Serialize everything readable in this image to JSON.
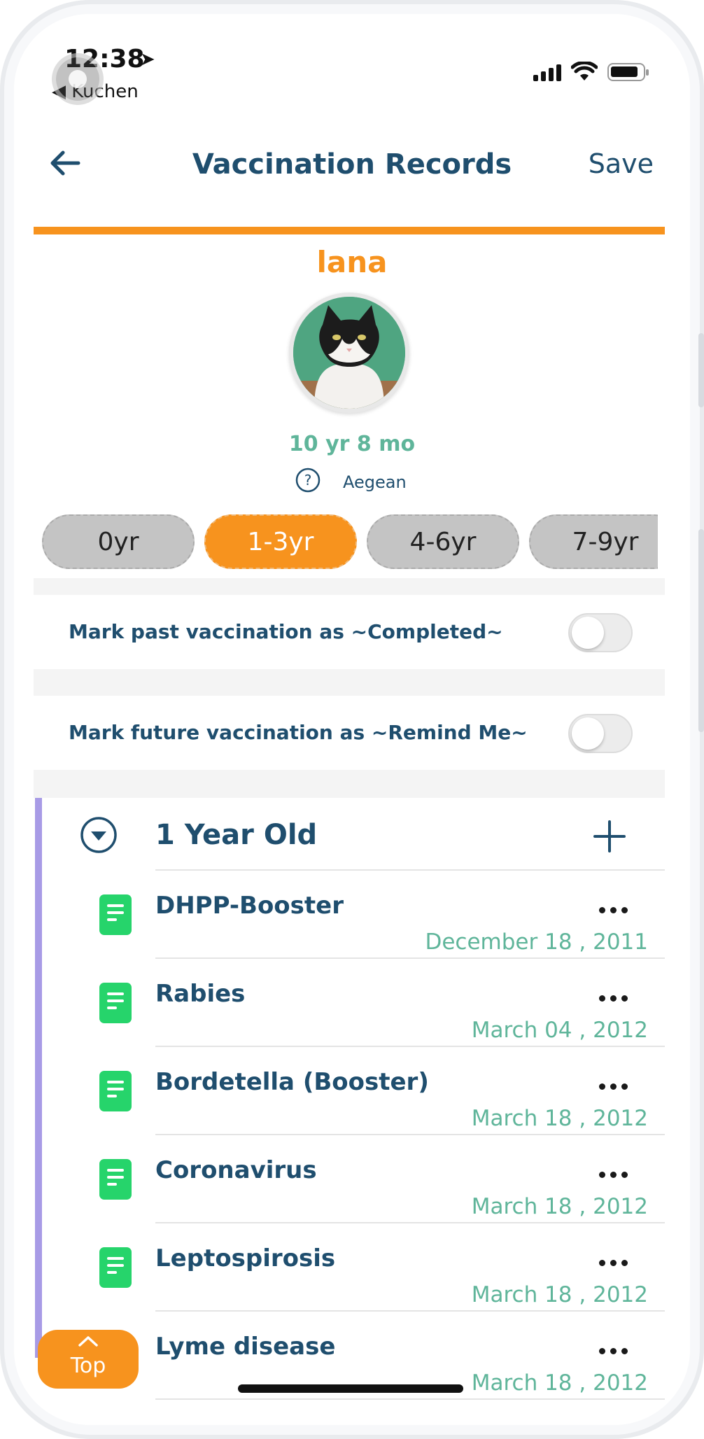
{
  "status_bar": {
    "time": "12:38",
    "back_app": "Kuchen"
  },
  "nav": {
    "title": "Vaccination Records",
    "save_label": "Save"
  },
  "pet": {
    "name": "lana",
    "age": "10 yr 8 mo",
    "breed": "Aegean"
  },
  "age_tabs": [
    {
      "label": "0yr",
      "active": false
    },
    {
      "label": "1-3yr",
      "active": true
    },
    {
      "label": "4-6yr",
      "active": false
    },
    {
      "label": "7-9yr",
      "active": false
    }
  ],
  "toggles": [
    {
      "label": "Mark past vaccination as ~Completed~",
      "on": false
    },
    {
      "label": "Mark future vaccination as ~Remind Me~",
      "on": false
    }
  ],
  "group": {
    "title": "1 Year Old",
    "items": [
      {
        "name": "DHPP-Booster",
        "date": "December 18 , 2011"
      },
      {
        "name": "Rabies",
        "date": "March 04 , 2012"
      },
      {
        "name": "Bordetella (Booster)",
        "date": "March 18 , 2012"
      },
      {
        "name": "Coronavirus",
        "date": "March 18 , 2012"
      },
      {
        "name": "Leptospirosis",
        "date": "March 18 , 2012"
      },
      {
        "name": "Lyme disease",
        "date": "March 18 , 2012"
      }
    ]
  },
  "scroll_top": {
    "label": "Top"
  },
  "colors": {
    "brand_orange": "#f7931e",
    "navy": "#1f4e6e",
    "teal": "#5fb59a",
    "doc_green": "#26d46b",
    "accent_purple": "#a89be6"
  },
  "icons": [
    "back-arrow-icon",
    "help-icon",
    "collapse-chevron-icon",
    "plus-icon",
    "document-icon",
    "more-dots-icon",
    "chevron-up-icon"
  ]
}
